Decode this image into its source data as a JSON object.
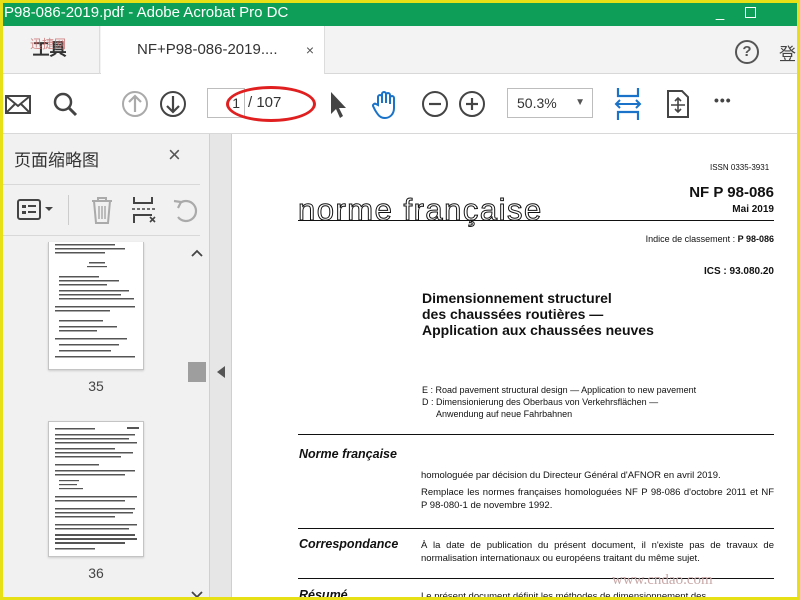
{
  "window": {
    "title": "P98-086-2019.pdf - Adobe Acrobat Pro DC",
    "minimize": "_"
  },
  "tabs": {
    "tools_label": "工具",
    "tools_watermark": "迅捷网",
    "document_tab": "NF+P98-086-2019....",
    "close": "×",
    "help": "?",
    "login": "登"
  },
  "toolbar": {
    "current_page": "1",
    "page_total": "/ 107",
    "zoom": "50.3%",
    "zoom_arrow": "▼",
    "more": "•••"
  },
  "panel": {
    "title": "页面缩略图",
    "close": "×",
    "thumbnails": [
      {
        "label": "35"
      },
      {
        "label": "36"
      }
    ]
  },
  "document": {
    "issn": "ISSN 0335-3931",
    "code": "NF P 98-086",
    "date": "Mai 2019",
    "norme": "norme française",
    "indice_label": "Indice de classement : ",
    "indice_value": "P 98-086",
    "ics": "ICS : 93.080.20",
    "title_lines": [
      "Dimensionnement structurel",
      "des chaussées routières —",
      "Application aux chaussées neuves"
    ],
    "translations": [
      "E : Road pavement structural design — Application to new pavement",
      "D : Dimensionierung des Oberbaus von Verkehrsflächen —",
      "Anwendung auf neue Fahrbahnen"
    ],
    "sections": [
      {
        "label": "Norme française",
        "texts": [
          "homologuée par décision du Directeur Général d'AFNOR en avril 2019.",
          "Remplace les normes françaises homologuées NF P 98-086 d'octobre 2011 et NF P 98-080-1 de novembre 1992."
        ]
      },
      {
        "label": "Correspondance",
        "texts": [
          "À la date de publication du présent document, il n'existe pas de travaux de normalisation internationaux ou européens traitant du même sujet."
        ]
      },
      {
        "label": "Résumé",
        "texts": [
          "Le présent document définit les méthodes de dimensionnement des..."
        ]
      }
    ]
  },
  "watermark": "www.cndao.com"
}
